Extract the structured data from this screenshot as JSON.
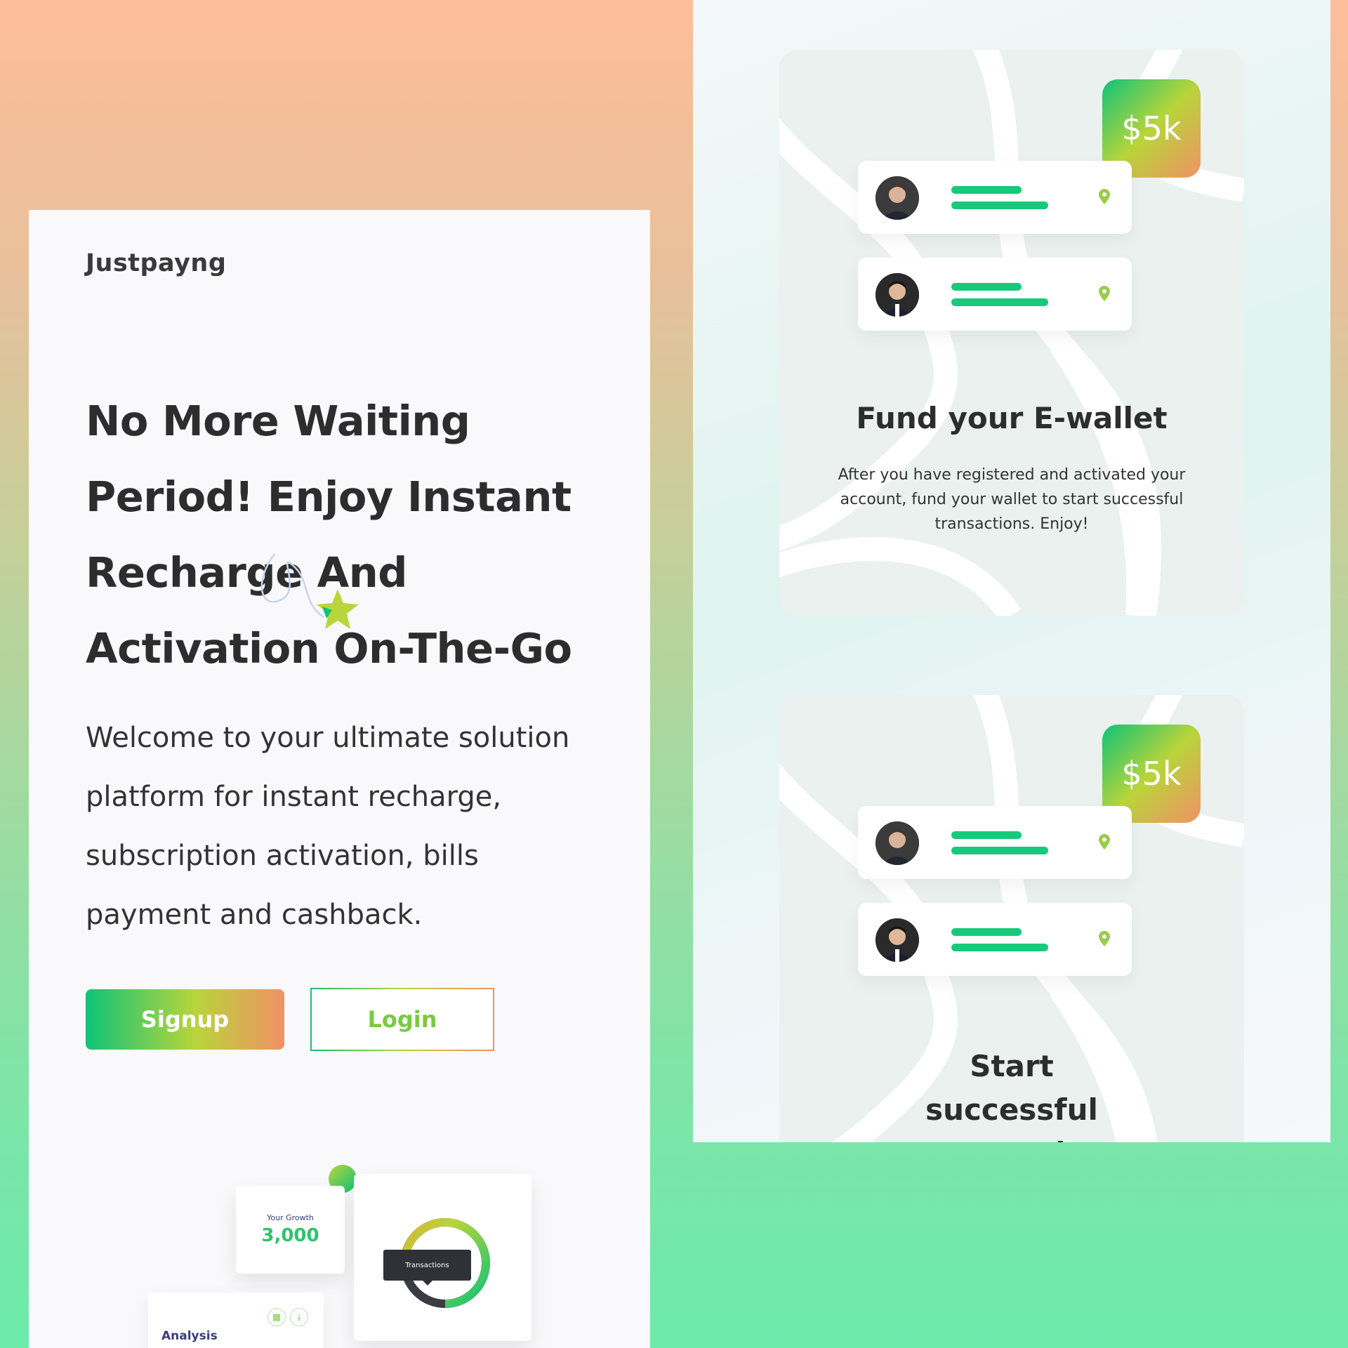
{
  "brand": {
    "name": "Justpayng"
  },
  "hero": {
    "title_lines": [
      "No More Waiting",
      "Period! Enjoy Instant",
      "Recharge And",
      "Activation On-The-Go"
    ],
    "description_lines": [
      "Welcome to your ultimate solution",
      "platform for instant recharge,",
      "subscription activation, bills",
      "payment and cashback."
    ]
  },
  "actions": {
    "signup_label": "Signup",
    "login_label": "Login"
  },
  "dashboard": {
    "growth_label": "Your Growth",
    "growth_value": "3,000",
    "transactions_label": "Transactions",
    "analysis_label": "Analysis"
  },
  "steps": [
    {
      "amount": "$5k",
      "title": "Fund your E-wallet",
      "description": "After you have registered and activated your account, fund your wallet to start successful transactions. Enjoy!"
    },
    {
      "amount": "$5k",
      "title": "Start successful transaction",
      "description": ""
    }
  ],
  "colors": {
    "green": "#0fc378",
    "lime": "#b8d53a",
    "orange": "#f29166",
    "text_dark": "#2d2d2d"
  },
  "icons": [
    "grid-icon",
    "download-icon",
    "location-pin-icon",
    "star-icon"
  ]
}
